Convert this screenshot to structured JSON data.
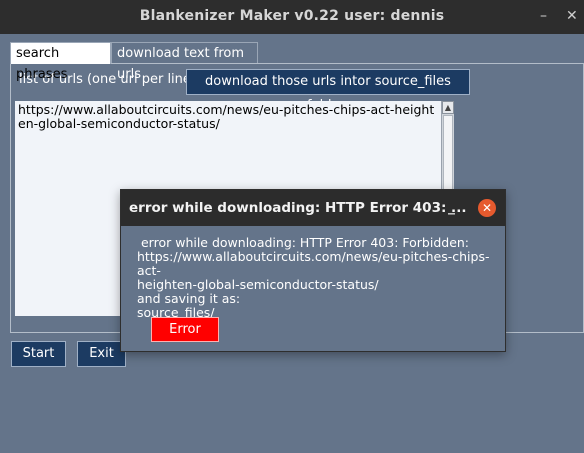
{
  "window": {
    "title": "Blankenizer Maker v0.22 user: dennis",
    "minimize_glyph": "–",
    "close_glyph": "✕"
  },
  "tabs": [
    {
      "label": "search phrases",
      "active": true
    },
    {
      "label": "download text from urls",
      "active": false
    }
  ],
  "url_tab": {
    "list_label": "list of urls (one url per line)",
    "download_button": "download those urls intor source_files folder:",
    "urls_text": "https://www.allaboutcircuits.com/news/eu-pitches-chips-act-heighten-global-semiconductor-status/",
    "scroll_up_glyph": "▲"
  },
  "footer": {
    "start_label": "Start",
    "exit_label": "Exit"
  },
  "dialog": {
    "title": "error while downloading: HTTP Error 403: ...",
    "minimize_glyph": "_",
    "close_glyph": "✕",
    "message": " error while downloading: HTTP Error 403: Forbidden:\nhttps://www.allaboutcircuits.com/news/eu-pitches-chips-act-\nheighten-global-semiconductor-status/\nand saving it as:\nsource_files/",
    "button_label": "Error"
  },
  "colors": {
    "background": "#64748a",
    "titlebar": "#2d2d2d",
    "dark_button": "#1c3b62",
    "error_button": "#ff0000",
    "close_circle": "#e65a2e"
  }
}
